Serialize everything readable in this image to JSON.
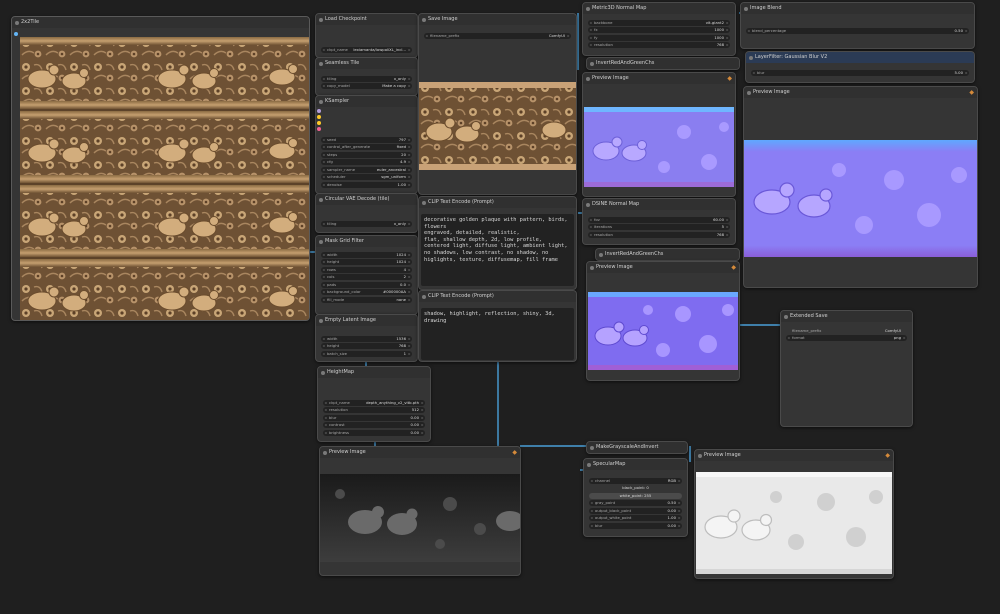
{
  "colors": {
    "canvas": "#1f1f1f",
    "node": "#353535",
    "wire": "#4a9fd8",
    "pin": "#d58a3a"
  },
  "nodes": {
    "tile": {
      "title": "2x2Tile"
    },
    "load_checkpoint": {
      "title": "Load Checkpoint",
      "ckpt_label": "ckpt_name",
      "ckpt_value": "lexiamanta/lowpoliXL_incl..."
    },
    "seamless": {
      "title": "Seamless Tile",
      "tiling_label": "tiling",
      "tiling_value": "x_only",
      "copy_label": "copy_model",
      "copy_value": "Make a copy"
    },
    "ksampler": {
      "title": "KSampler",
      "rows": [
        {
          "label": "seed",
          "value": "797"
        },
        {
          "label": "control_after_generate",
          "value": "fixed"
        },
        {
          "label": "steps",
          "value": "20"
        },
        {
          "label": "cfg",
          "value": "4.9"
        },
        {
          "label": "sampler_name",
          "value": "euler_ancestral"
        },
        {
          "label": "scheduler",
          "value": "sgm_uniform"
        },
        {
          "label": "denoise",
          "value": "1.00"
        }
      ]
    },
    "circular": {
      "title": "Circular VAE Decode (tile)",
      "tiling_label": "tiling",
      "tiling_value": "x_only"
    },
    "gridfilter": {
      "title": "Mask Grid Filter",
      "rows": [
        {
          "label": "width",
          "value": "1024"
        },
        {
          "label": "height",
          "value": "1024"
        },
        {
          "label": "rows",
          "value": "4"
        },
        {
          "label": "cols",
          "value": "2"
        },
        {
          "label": "pads",
          "value": "0.0"
        },
        {
          "label": "background_color",
          "value": "#000000AA"
        },
        {
          "label": "fill_mode",
          "value": "none"
        }
      ]
    },
    "empty_latent": {
      "title": "Empty Latent Image",
      "rows": [
        {
          "label": "width",
          "value": "1536"
        },
        {
          "label": "height",
          "value": "768"
        },
        {
          "label": "batch_size",
          "value": "1"
        }
      ]
    },
    "heightmap": {
      "title": "HeightMap",
      "rows": [
        {
          "label": "ckpt_name",
          "value": "depth_anything_v2_vitb.pth"
        },
        {
          "label": "resolution",
          "value": "512"
        },
        {
          "label": "blur",
          "value": "0.00"
        },
        {
          "label": "contrast",
          "value": "0.00"
        },
        {
          "label": "brightness",
          "value": "0.00"
        }
      ]
    },
    "preview_height": {
      "title": "Preview Image"
    },
    "save_image": {
      "title": "Save Image",
      "prefix_label": "filename_prefix",
      "prefix_value": "ComfyUI"
    },
    "clip_pos": {
      "title": "CLIP Text Encode (Prompt)",
      "text": "decorative golden plaque with pattern, birds, flowers\nengraved, detailed, realistic,\nflat, shallow depth, 2d, low profile,\ncentered light, diffuse light, ambient light, no shadows, low contrast, no shadow, no higlights, texture, diffusemap, fill frame"
    },
    "clip_neg": {
      "title": "CLIP Text Encode (Prompt)",
      "text": "shadow, highlight, reflection, shiny, 3d, drawing"
    },
    "metric_normal": {
      "title": "Metric3D Normal Map",
      "rows": [
        {
          "label": "backbone",
          "value": "vit-giant2"
        },
        {
          "label": "fx",
          "value": "1000"
        },
        {
          "label": "fy",
          "value": "1000"
        },
        {
          "label": "resolution",
          "value": "768"
        }
      ]
    },
    "invert_green1": {
      "title": "InvertRedAndGreenChs"
    },
    "preview_normal1": {
      "title": "Preview Image"
    },
    "dsine": {
      "title": "DSINE Normal Map",
      "rows": [
        {
          "label": "fov",
          "value": "60.00"
        },
        {
          "label": "iterations",
          "value": "5"
        },
        {
          "label": "resolution",
          "value": "768"
        }
      ]
    },
    "invert_green2": {
      "title": "InvertRedAndGreenChs"
    },
    "preview_normal2": {
      "title": "Preview Image"
    },
    "image_blend": {
      "title": "Image Blend",
      "rows": [
        {
          "label": "blend_percentage",
          "value": "0.50"
        }
      ]
    },
    "layer_blur": {
      "title": "LayerFilter: Gaussian Blur V2",
      "rows": [
        {
          "label": "blur",
          "value": "5.00"
        }
      ]
    },
    "preview_blend": {
      "title": "Preview Image"
    },
    "extended_save": {
      "title": "Extended Save",
      "rows": [
        {
          "label": "filename_prefix",
          "value": "ComfyUI"
        },
        {
          "label": "format",
          "value": "png"
        }
      ]
    },
    "grayscale": {
      "title": "MakeGrayscaleAndInvert"
    },
    "specular": {
      "title": "SpecularMap",
      "channel_label": "channel",
      "channel_value": "RGB",
      "black_point": "black_point: 0",
      "white_point": "white_point: 255",
      "rows": [
        {
          "label": "gray_point",
          "value": "0.50"
        },
        {
          "label": "output_black_point",
          "value": "0.00"
        },
        {
          "label": "output_white_point",
          "value": "1.00"
        },
        {
          "label": "blur",
          "value": "0.00"
        }
      ]
    },
    "preview_spec": {
      "title": "Preview Image"
    }
  }
}
